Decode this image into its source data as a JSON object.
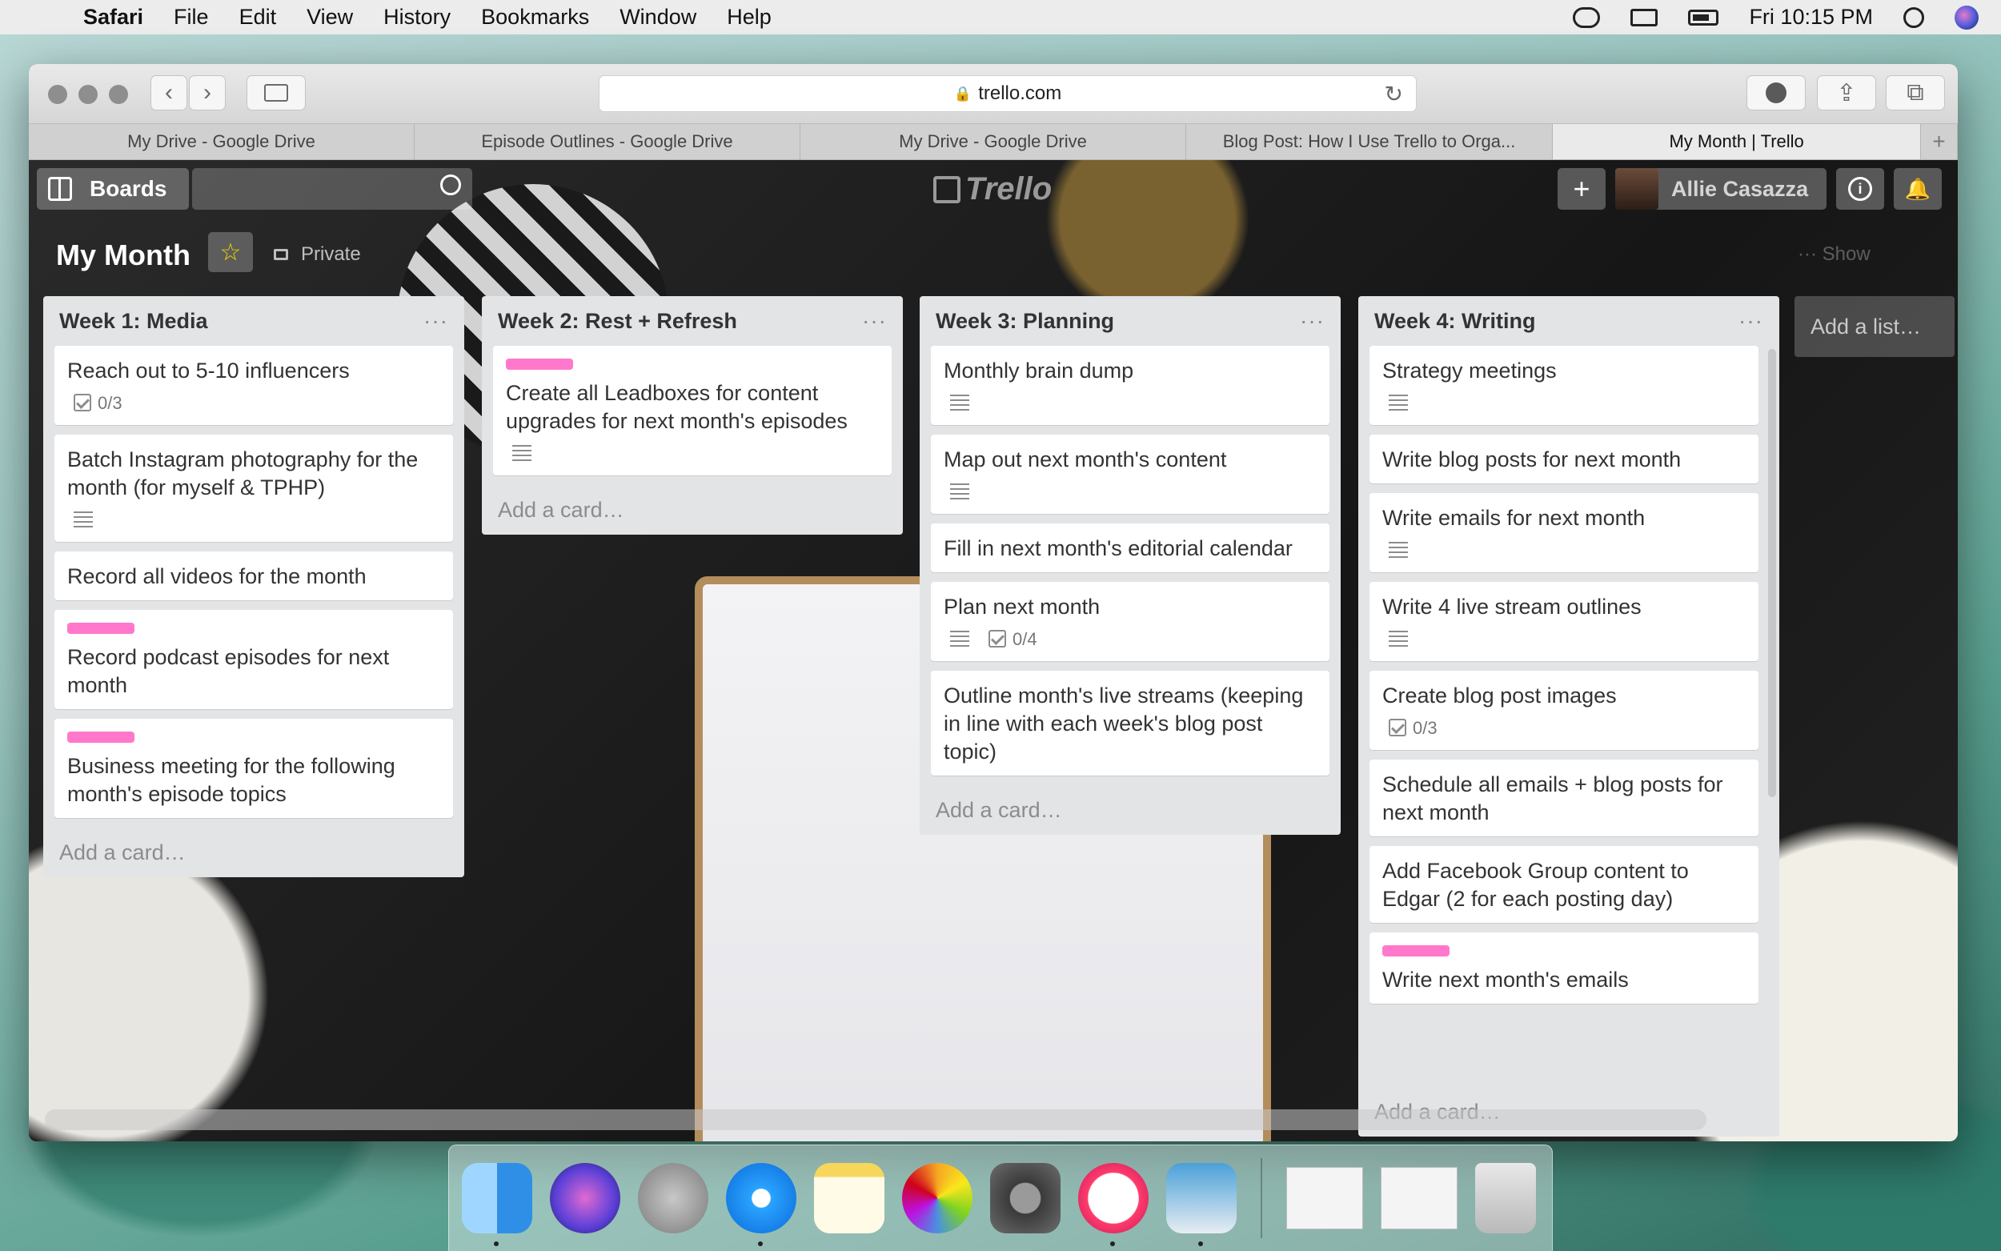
{
  "menubar": {
    "app": "Safari",
    "items": [
      "File",
      "Edit",
      "View",
      "History",
      "Bookmarks",
      "Window",
      "Help"
    ],
    "clock": "Fri 10:15 PM"
  },
  "browser": {
    "url": "trello.com",
    "tabs": [
      "My Drive - Google Drive",
      "Episode Outlines - Google Drive",
      "My Drive - Google Drive",
      "Blog Post: How I Use Trello to Orga...",
      "My Month | Trello"
    ]
  },
  "trello": {
    "boards_label": "Boards",
    "logo": "Trello",
    "user": "Allie Casazza",
    "board_title": "My Month",
    "visibility": "Private",
    "show_menu": "··· Show",
    "add_list": "Add a list…",
    "add_card": "Add a card…"
  },
  "lists": [
    {
      "title": "Week 1: Media",
      "cards": [
        {
          "text": "Reach out to 5-10 influencers",
          "check": "0/3"
        },
        {
          "text": "Batch Instagram photography for the month (for myself & TPHP)",
          "desc": true
        },
        {
          "text": "Record all videos for the month"
        },
        {
          "text": "Record podcast episodes for next month",
          "label": "#ff78cb"
        },
        {
          "text": "Business meeting for the following month's episode topics",
          "label": "#ff78cb"
        }
      ]
    },
    {
      "title": "Week 2: Rest + Refresh",
      "cards": [
        {
          "text": "Create all Leadboxes for content upgrades for next month's episodes",
          "label": "#ff78cb",
          "desc": true
        }
      ]
    },
    {
      "title": "Week 3: Planning",
      "cards": [
        {
          "text": "Monthly brain dump",
          "desc": true
        },
        {
          "text": "Map out next month's content",
          "desc": true
        },
        {
          "text": "Fill in next month's editorial calendar"
        },
        {
          "text": "Plan next month",
          "desc": true,
          "check": "0/4"
        },
        {
          "text": "Outline month's live streams (keeping in line with each week's blog post topic)"
        }
      ]
    },
    {
      "title": "Week 4: Writing",
      "cards": [
        {
          "text": "Strategy meetings",
          "desc": true
        },
        {
          "text": "Write blog posts for next month"
        },
        {
          "text": "Write emails for next month",
          "desc": true
        },
        {
          "text": "Write 4 live stream outlines",
          "desc": true
        },
        {
          "text": "Create blog post images",
          "check": "0/3"
        },
        {
          "text": "Schedule all emails + blog posts for next month"
        },
        {
          "text": "Add Facebook Group content to Edgar (2 for each posting day)"
        },
        {
          "text": "Write next month's emails",
          "label": "#ff78cb"
        }
      ]
    }
  ],
  "dock": {
    "apps": [
      "finder-icon",
      "siri-icon",
      "launchpad-icon",
      "safari-icon",
      "notes-icon",
      "photos-icon",
      "system-preferences-icon",
      "itunes-icon",
      "preview-icon"
    ]
  }
}
